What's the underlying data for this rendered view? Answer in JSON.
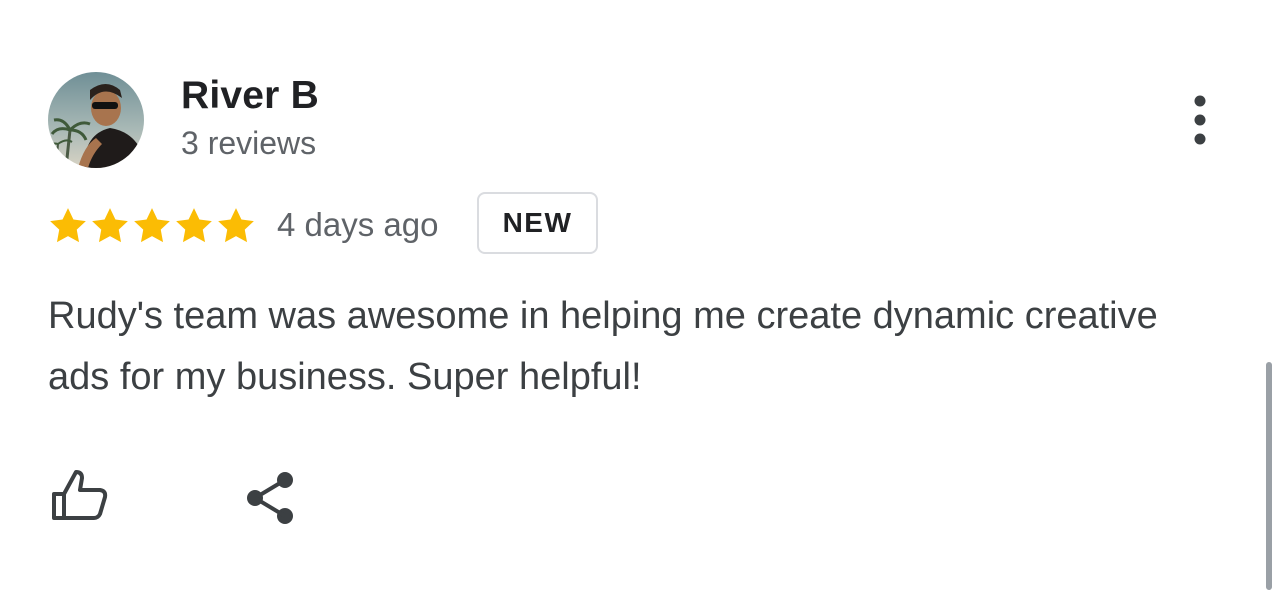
{
  "review": {
    "reviewer_name": "River B",
    "review_count": "3 reviews",
    "rating": 5,
    "rating_max": 5,
    "date": "4 days ago",
    "badge": "NEW",
    "text": "Rudy's team was awesome in helping me create dynamic creative ads for my business. Super helpful!"
  },
  "icons": {
    "more": "more-vert-icon",
    "like": "thumb-up-icon",
    "share": "share-icon",
    "star": "star-icon"
  },
  "colors": {
    "star": "#fbbc04",
    "text_primary": "#202124",
    "text_secondary": "#5f6368",
    "badge_border": "#dadce0",
    "icon": "#3c4043"
  }
}
